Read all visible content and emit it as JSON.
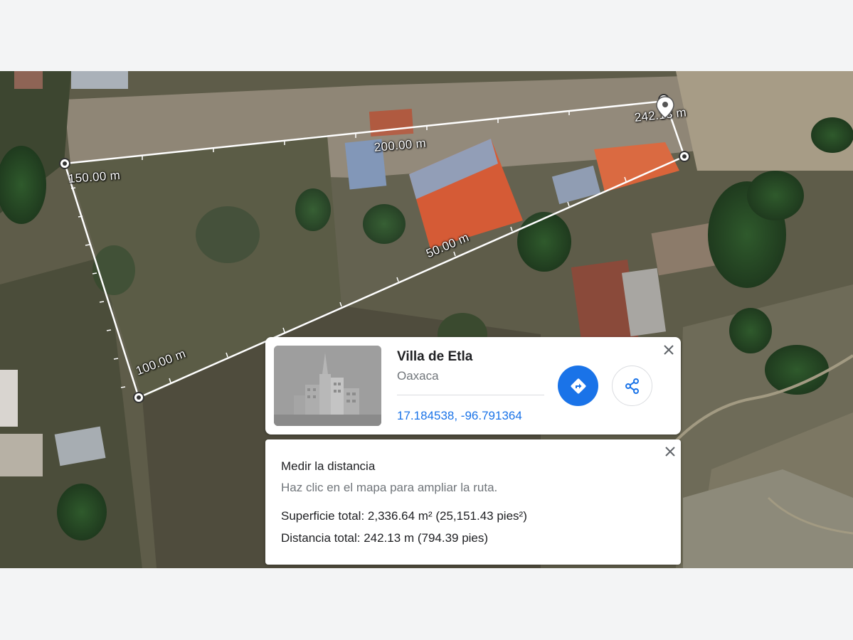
{
  "map": {
    "type": "satellite",
    "measure_labels": [
      "150.00 m",
      "200.00 m",
      "242.13 m",
      "50.00 m",
      "100.00 m"
    ]
  },
  "place_card": {
    "name": "Villa de Etla",
    "region": "Oaxaca",
    "coordinates": "17.184538, -96.791364",
    "directions_icon": "directions-icon",
    "share_icon": "share-icon",
    "close_icon": "close-icon"
  },
  "measure_card": {
    "title": "Medir la distancia",
    "hint": "Haz clic en el mapa para ampliar la ruta.",
    "total_area": "Superficie total: 2,336.64 m² (25,151.43 pies²)",
    "total_distance": "Distancia total: 242.13 m (794.39 pies)",
    "close_icon": "close-icon"
  },
  "colors": {
    "accent": "#1a73e8",
    "measure_line": "#ffffff",
    "page_background": "#f3f4f5"
  }
}
